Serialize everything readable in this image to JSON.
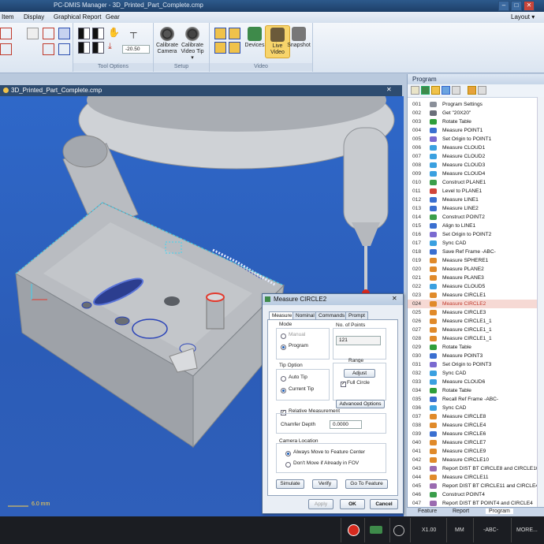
{
  "window": {
    "title": "PC-DMIS Manager - 3D_Printed_Part_Complete.cmp",
    "controls": [
      "–",
      "□",
      "✕"
    ],
    "layout_label": "Layout ▾"
  },
  "menu": [
    "Item",
    "Display",
    "Graphical Report",
    "Gear"
  ],
  "ribbon": {
    "groups": [
      {
        "caption": "Tool Options"
      },
      {
        "caption": "Setup"
      },
      {
        "caption": "Video"
      }
    ],
    "tool_value": "-20.50",
    "buttons": {
      "calibrate_camera": "Calibrate Camera",
      "calibrate_video_tip": "Calibrate Video Tip ▾",
      "devices": "Devices",
      "live_video": "Live Video",
      "snapshot": "Snapshot"
    }
  },
  "document": {
    "tab_title": "3D_Printed_Part_Complete.cmp",
    "scale_label": "6.0 mm"
  },
  "program": {
    "panel_title": "Program",
    "rows": [
      {
        "num": "001",
        "text": "Program Settings",
        "color": "#8a8f99"
      },
      {
        "num": "002",
        "text": "Get \"20X20\"",
        "color": "#6a6f79"
      },
      {
        "num": "003",
        "text": "Rotate Table",
        "color": "#2e9e3a"
      },
      {
        "num": "004",
        "text": "Measure POINT1",
        "color": "#3a6fd0"
      },
      {
        "num": "005",
        "text": "Set Origin to POINT1",
        "color": "#7a6ad0"
      },
      {
        "num": "006",
        "text": "Measure CLOUD1",
        "color": "#3aa0e0"
      },
      {
        "num": "007",
        "text": "Measure CLOUD2",
        "color": "#3aa0e0"
      },
      {
        "num": "008",
        "text": "Measure CLOUD3",
        "color": "#3aa0e0"
      },
      {
        "num": "009",
        "text": "Measure CLOUD4",
        "color": "#3aa0e0"
      },
      {
        "num": "010",
        "text": "Construct PLANE1",
        "color": "#3a9e4a"
      },
      {
        "num": "011",
        "text": "Level to PLANE1",
        "color": "#d0453a"
      },
      {
        "num": "012",
        "text": "Measure LINE1",
        "color": "#3a6fd0"
      },
      {
        "num": "013",
        "text": "Measure LINE2",
        "color": "#3a6fd0"
      },
      {
        "num": "014",
        "text": "Construct POINT2",
        "color": "#3a9e4a"
      },
      {
        "num": "015",
        "text": "Align to LINE1",
        "color": "#3a6fd0"
      },
      {
        "num": "016",
        "text": "Set Origin to POINT2",
        "color": "#7a6ad0"
      },
      {
        "num": "017",
        "text": "Sync CAD",
        "color": "#3aa0e0"
      },
      {
        "num": "018",
        "text": "Save Ref Frame -ABC-",
        "color": "#3a6fd0"
      },
      {
        "num": "019",
        "text": "Measure SPHERE1",
        "color": "#e08a2a"
      },
      {
        "num": "020",
        "text": "Measure PLANE2",
        "color": "#e08a2a"
      },
      {
        "num": "021",
        "text": "Measure PLANE3",
        "color": "#e08a2a"
      },
      {
        "num": "022",
        "text": "Measure CLOUD5",
        "color": "#3aa0e0"
      },
      {
        "num": "023",
        "text": "Measure CIRCLE1",
        "color": "#e08a2a"
      },
      {
        "num": "024",
        "text": "Measure CIRCLE2",
        "color": "#e08a2a",
        "selected": true
      },
      {
        "num": "025",
        "text": "Measure CIRCLE3",
        "color": "#e08a2a"
      },
      {
        "num": "026",
        "text": "Measure CIRCLE1_1",
        "color": "#e08a2a"
      },
      {
        "num": "027",
        "text": "Measure CIRCLE1_1",
        "color": "#e08a2a"
      },
      {
        "num": "028",
        "text": "Measure CIRCLE1_1",
        "color": "#e08a2a"
      },
      {
        "num": "029",
        "text": "Rotate Table",
        "color": "#2e9e3a"
      },
      {
        "num": "030",
        "text": "Measure POINT3",
        "color": "#3a6fd0"
      },
      {
        "num": "031",
        "text": "Set Origin to POINT3",
        "color": "#7a6ad0"
      },
      {
        "num": "032",
        "text": "Sync CAD",
        "color": "#3aa0e0"
      },
      {
        "num": "033",
        "text": "Measure CLOUD6",
        "color": "#3aa0e0"
      },
      {
        "num": "034",
        "text": "Rotate Table",
        "color": "#2e9e3a"
      },
      {
        "num": "035",
        "text": "Recall Ref Frame -ABC-",
        "color": "#3a6fd0"
      },
      {
        "num": "036",
        "text": "Sync CAD",
        "color": "#3aa0e0"
      },
      {
        "num": "037",
        "text": "Measure CIRCLE8",
        "color": "#e08a2a"
      },
      {
        "num": "038",
        "text": "Measure CIRCLE4",
        "color": "#e08a2a"
      },
      {
        "num": "039",
        "text": "Measure CIRCLE6",
        "color": "#3a6fd0"
      },
      {
        "num": "040",
        "text": "Measure CIRCLE7",
        "color": "#e08a2a"
      },
      {
        "num": "041",
        "text": "Measure CIRCLE9",
        "color": "#e08a2a"
      },
      {
        "num": "042",
        "text": "Measure CIRCLE10",
        "color": "#e08a2a"
      },
      {
        "num": "043",
        "text": "Report DIST BT CIRCLE8 and CIRCLE10",
        "color": "#9a6ab0"
      },
      {
        "num": "044",
        "text": "Measure CIRCLE11",
        "color": "#e08a2a"
      },
      {
        "num": "045",
        "text": "Report DIST BT CIRCLE11 and CIRCLE4",
        "color": "#9a6ab0"
      },
      {
        "num": "046",
        "text": "Construct POINT4",
        "color": "#3a9e4a"
      },
      {
        "num": "047",
        "text": "Report DIST BT POINT4 and CIRCLE4",
        "color": "#9a6ab0"
      }
    ],
    "tabs": [
      "Feature",
      "Report",
      "Program"
    ]
  },
  "dialog": {
    "title": "Measure CIRCLE2",
    "tabs": [
      "Measure",
      "Nominal",
      "Commands",
      "Prompt"
    ],
    "mode_label": "Mode",
    "mode_manual": "Manual",
    "mode_program": "Program",
    "points_label": "No. of Points",
    "points_value": "121",
    "tip_label": "Tip Option",
    "tip_auto": "Auto Tip",
    "tip_current": "Current Tip",
    "range_label": "Range",
    "adjust_label": "Adjust",
    "full_circle": "Full Circle",
    "advanced": "Advanced Options",
    "relative": "Relative Measurement",
    "chamfer_label": "Chamfer Depth",
    "chamfer_value": "0.0000",
    "camera_label": "Camera Location",
    "camera_always": "Always Move to Feature Center",
    "camera_dont": "Don't Move if Already in FOV",
    "simulate": "Simulate",
    "verify": "Verify",
    "goto": "Go To Feature",
    "apply": "Apply",
    "ok": "OK",
    "cancel": "Cancel"
  },
  "status": {
    "zoom": "X1.00",
    "units": "MM",
    "frame": "-ABC-",
    "more": "MORE..."
  }
}
